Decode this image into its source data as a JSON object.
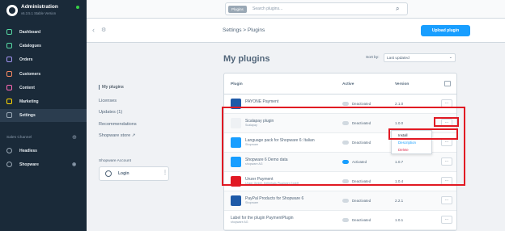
{
  "app": {
    "name": "Administration",
    "version": "v6.3.5.1 Stable Version",
    "status_color": "#37d046"
  },
  "sidebar": {
    "items": [
      {
        "label": "Dashboard",
        "icon": "dashboard-icon"
      },
      {
        "label": "Catalogues",
        "icon": "catalogue-icon"
      },
      {
        "label": "Orders",
        "icon": "orders-icon"
      },
      {
        "label": "Customers",
        "icon": "customers-icon"
      },
      {
        "label": "Content",
        "icon": "content-icon"
      },
      {
        "label": "Marketing",
        "icon": "marketing-icon"
      },
      {
        "label": "Settings",
        "icon": "settings-icon",
        "active": true
      }
    ],
    "sales_channel_title": "Sales Channel",
    "sales_channels": [
      {
        "label": "Headless",
        "icon": "headless-icon"
      },
      {
        "label": "Shopware",
        "icon": "storefront-icon"
      }
    ]
  },
  "search": {
    "pill": "Plugins",
    "placeholder": "Search plugins..."
  },
  "header": {
    "breadcrumb": "Settings > Plugins",
    "upload_label": "Upload plugin"
  },
  "page": {
    "title": "My plugins",
    "sort_label": "Sort by:",
    "sort_value": "Last updated"
  },
  "subnav": {
    "items": [
      {
        "label": "My plugins",
        "selected": true
      },
      {
        "label": "Licenses"
      },
      {
        "label": "Updates (1)"
      },
      {
        "label": "Recommendations"
      },
      {
        "label": "Shopware store ↗"
      }
    ]
  },
  "account": {
    "title": "Shopware Account",
    "login_label": "Login"
  },
  "grid": {
    "columns": {
      "plugin": "Plugin",
      "active": "Active",
      "version": "Version"
    },
    "rows": [
      {
        "name": "PAYONE Payment",
        "author": "",
        "status": "Deactivated",
        "version": "2.1.0",
        "active": false,
        "icon_color": "#1e5aa8"
      },
      {
        "name": "Scalapay plugin",
        "author": "Scalapay",
        "status": "Deactivated",
        "version": "1.0.0",
        "active": false,
        "icon_color": "#eef1f4"
      },
      {
        "name": "Language pack for Shopware 6: Italian",
        "author": "Shopware",
        "status": "Deactivated",
        "version": "1.0.9",
        "active": false,
        "icon_color": "#189eff"
      },
      {
        "name": "Shopware 6 Demo data",
        "author": "shopware AG",
        "status": "Activated",
        "version": "1.0.7",
        "active": true,
        "icon_color": "#189eff"
      },
      {
        "name": "Unzer Payment",
        "author": "Unzer GmbH, Kellerhals Plugineer GmbH",
        "status": "Deactivated",
        "version": "1.0.4",
        "active": false,
        "icon_color": "#e11923"
      },
      {
        "name": "PayPal Products for Shopware 6",
        "author": "Shopware",
        "status": "Deactivated",
        "version": "2.2.1",
        "active": false,
        "icon_color": "#1e5aa8"
      },
      {
        "name": "Label for the plugin PaymentPlugin",
        "author": "shopware AG",
        "status": "Deactivated",
        "version": "1.0.1",
        "active": false,
        "icon_color": "#ffffff"
      }
    ],
    "more_label": "···"
  },
  "context_menu": {
    "items": [
      {
        "label": "Install",
        "color": "#1a2a39"
      },
      {
        "label": "Description",
        "color": "#189eff"
      },
      {
        "label": "Delete",
        "color": "#de294c"
      }
    ]
  },
  "highlight_color": "#e11923"
}
